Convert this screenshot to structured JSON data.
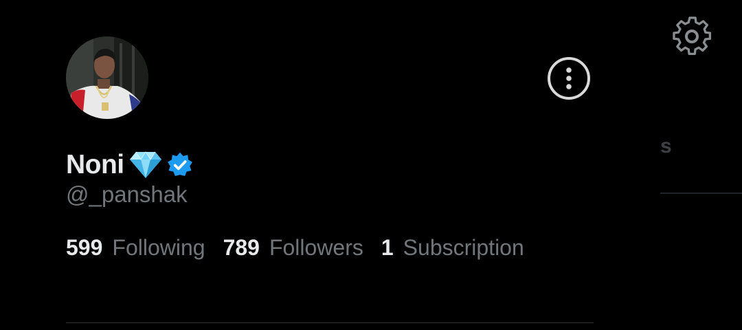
{
  "profile": {
    "display_name": "Noni",
    "badges": [
      "gem-emoji",
      "verified-badge"
    ],
    "handle": "@_panshak"
  },
  "stats": [
    {
      "count": "599",
      "label": "Following"
    },
    {
      "count": "789",
      "label": "Followers"
    },
    {
      "count": "1",
      "label": "Subscription"
    }
  ],
  "background_peek": {
    "tab_fragment": "s"
  },
  "icons": {
    "more": "more-options-icon",
    "settings": "gear-icon"
  },
  "colors": {
    "background": "#000000",
    "primary_text": "#e7e9ea",
    "secondary_text": "#71767b",
    "verified": "#1d9bf0",
    "divider": "#2f3336"
  }
}
